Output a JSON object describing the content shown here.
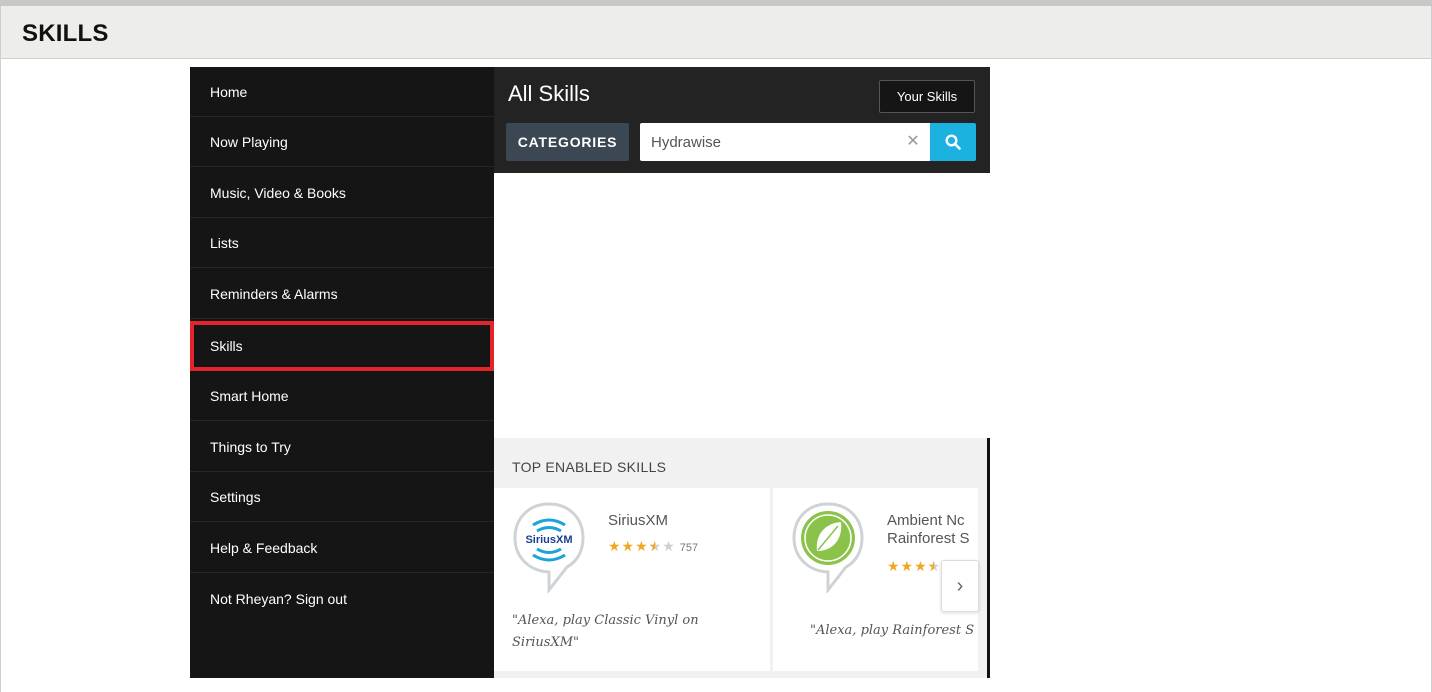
{
  "page": {
    "title": "SKILLS"
  },
  "sidebar": {
    "items": [
      {
        "label": "Home"
      },
      {
        "label": "Now Playing"
      },
      {
        "label": "Music, Video & Books"
      },
      {
        "label": "Lists"
      },
      {
        "label": "Reminders & Alarms"
      },
      {
        "label": "Skills",
        "selected": true
      },
      {
        "label": "Smart Home"
      },
      {
        "label": "Things to Try"
      },
      {
        "label": "Settings"
      },
      {
        "label": "Help & Feedback"
      },
      {
        "label": "Not Rheyan? Sign out"
      }
    ],
    "highlight_color": "#e3242b"
  },
  "header": {
    "title": "All Skills",
    "your_skills_label": "Your Skills",
    "categories_label": "CATEGORIES"
  },
  "search": {
    "value": "Hydrawise",
    "clear_icon": "close-icon",
    "button_icon": "search-icon",
    "button_color": "#1cb2e0"
  },
  "top_enabled": {
    "title": "TOP ENABLED SKILLS",
    "skills": [
      {
        "name": "SiriusXM",
        "logo_text": "SiriusXM",
        "rating": 3.5,
        "rating_max": 5,
        "review_count": "757",
        "quote": "\"Alexa, play Classic Vinyl on SiriusXM\""
      },
      {
        "name": "Ambient Nc",
        "name_line2": "Rainforest S",
        "rating": 3.5,
        "rating_max": 5,
        "quote": "\"Alexa, play Rainforest S"
      }
    ],
    "next_icon": "chevron-right-icon"
  },
  "colors": {
    "star": "#f0a821",
    "sidebar_bg": "#151515",
    "header_bg": "#232323"
  }
}
